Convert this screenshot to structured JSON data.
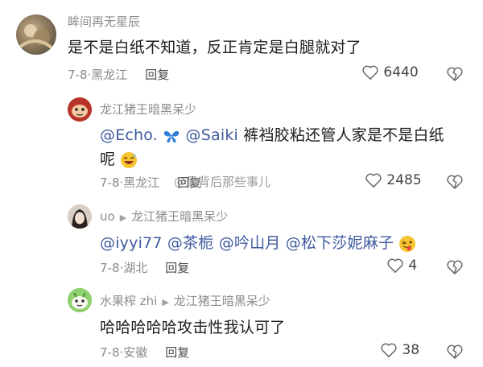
{
  "comments": [
    {
      "username": "眸间再无星辰",
      "text": "是不是白纸不知道，反正肯定是白腿就对了",
      "date": "7-8·黑龙江",
      "reply": "回复",
      "likes": "6440"
    },
    {
      "username": "龙江猪王暗黑呆少",
      "mention1": "@Echo.",
      "mention2": "@Saiki",
      "text": " 裤裆胶粘还管人家是不是白纸",
      "text2": "呢",
      "date": "7-8·黑龙江",
      "reply": "回复",
      "likes": "2485"
    },
    {
      "username": "uo",
      "reply_to": "龙江猪王暗黑呆少",
      "mentions": "@iyyi77 @茶栀 @吟山月 @松下莎妮麻子",
      "date": "7-8·湖北",
      "reply": "回复",
      "likes": "4"
    },
    {
      "username": "水果榨 zhi",
      "reply_to": "龙江猪王暗黑呆少",
      "text": "哈哈哈哈哈攻击性我认可了",
      "date": "7-8·安徽",
      "reply": "回复",
      "likes": "38"
    }
  ],
  "watermark": "@最背后那些事儿",
  "icons": {
    "like": "heart-outline-icon",
    "dislike": "broken-heart-icon"
  }
}
